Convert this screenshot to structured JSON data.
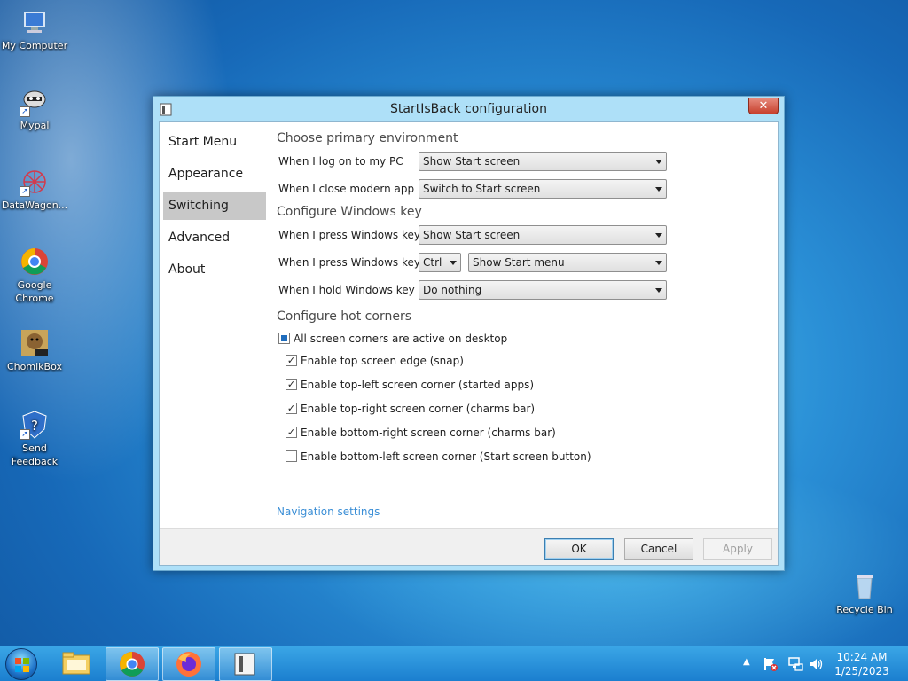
{
  "desktop": {
    "icons": [
      {
        "label": "My Computer",
        "icon": "computer-icon"
      },
      {
        "label": "Mypal",
        "icon": "mypal-icon"
      },
      {
        "label": "DataWagon...",
        "icon": "datawagon-icon"
      },
      {
        "label": "Google Chrome",
        "icon": "chrome-icon"
      },
      {
        "label": "ChomikBox",
        "icon": "chomikbox-icon"
      },
      {
        "label": "Send Feedback",
        "icon": "feedback-shield-icon"
      },
      {
        "label": "Recycle Bin",
        "icon": "recycle-bin-icon"
      }
    ]
  },
  "window": {
    "title": "StartIsBack configuration",
    "close_label": "✕"
  },
  "sidebar": {
    "items": [
      {
        "label": "Start Menu",
        "active": false
      },
      {
        "label": "Appearance",
        "active": false
      },
      {
        "label": "Switching",
        "active": true
      },
      {
        "label": "Advanced",
        "active": false
      },
      {
        "label": "About",
        "active": false
      }
    ]
  },
  "content": {
    "primary_env": {
      "heading": "Choose primary environment",
      "rows": [
        {
          "label": "When I log on to my PC",
          "value": "Show Start screen"
        },
        {
          "label": "When I close modern app",
          "value": "Switch to Start screen"
        }
      ]
    },
    "windows_key": {
      "heading": "Configure Windows key",
      "press_label": "When I press Windows key",
      "press_value": "Show Start screen",
      "combo_label": "When I press Windows key +",
      "combo_modifier": "Ctrl",
      "combo_value": "Show Start menu",
      "hold_label": "When I hold Windows key",
      "hold_value": "Do nothing"
    },
    "hot_corners": {
      "heading": "Configure hot corners",
      "master": {
        "label": "All screen corners are active on desktop",
        "state": "indeterminate"
      },
      "options": [
        {
          "label": "Enable top screen edge (snap)",
          "checked": true
        },
        {
          "label": "Enable top-left screen corner (started apps)",
          "checked": true
        },
        {
          "label": "Enable top-right screen corner (charms bar)",
          "checked": true
        },
        {
          "label": "Enable bottom-right screen corner (charms bar)",
          "checked": true
        },
        {
          "label": "Enable bottom-left screen corner (Start screen button)",
          "checked": false
        }
      ]
    },
    "nav_link": "Navigation settings"
  },
  "footer": {
    "ok": "OK",
    "cancel": "Cancel",
    "apply": "Apply"
  },
  "taskbar": {
    "apps": [
      "windows-start-orb",
      "file-explorer-icon",
      "chrome-icon",
      "firefox-icon",
      "startisback-icon"
    ],
    "time": "10:24 AM",
    "date": "1/25/2023"
  },
  "colors": {
    "accent": "#3a8ed6",
    "selected_sidebar": "#c8c8c8",
    "window_frame": "#aee0f8"
  }
}
